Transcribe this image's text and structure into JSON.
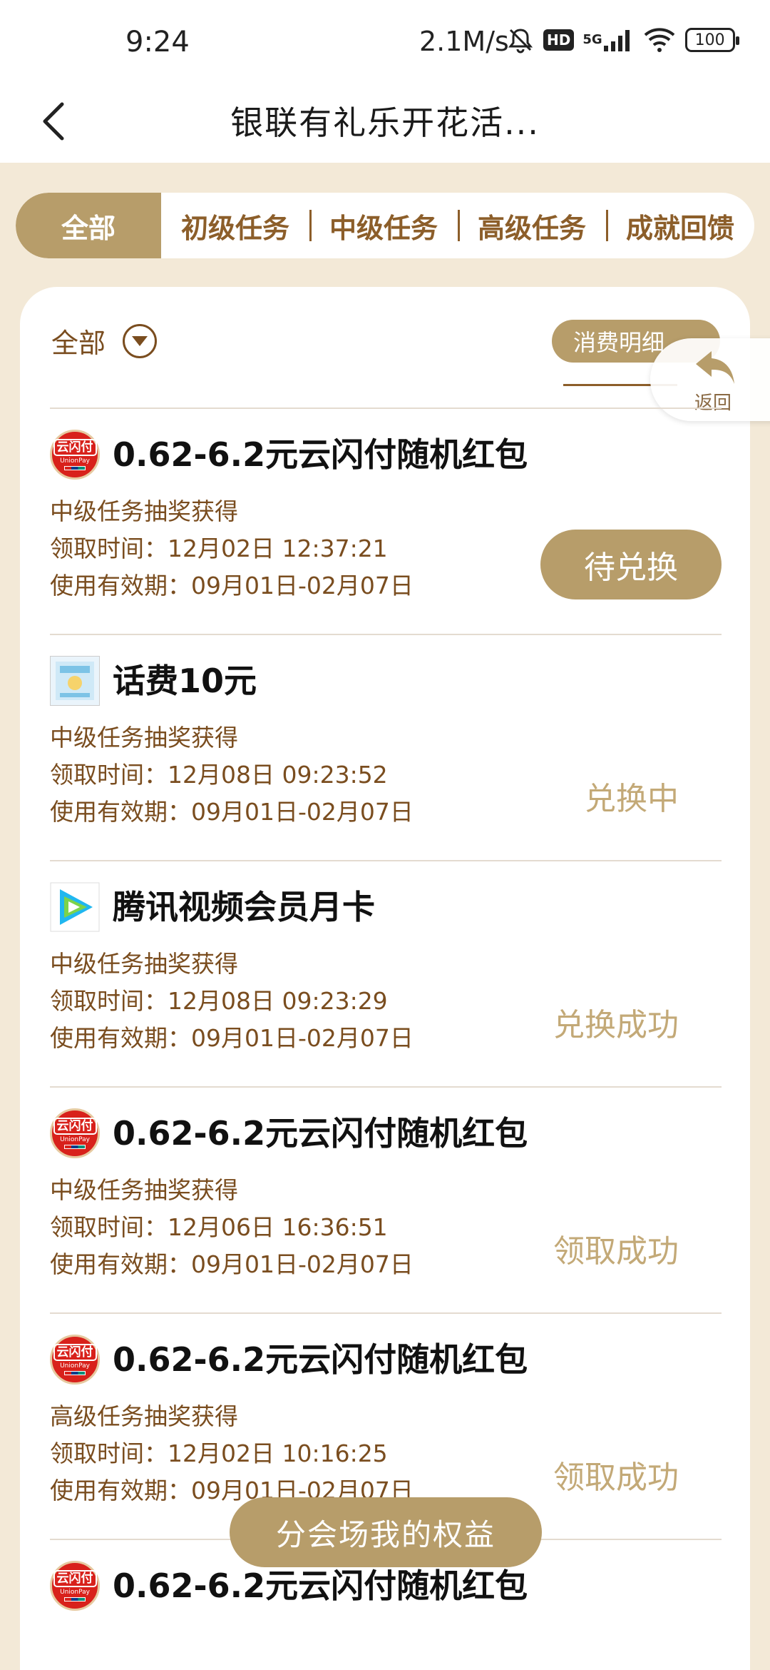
{
  "status_bar": {
    "time": "9:24",
    "network_speed": "2.1M/s",
    "hd_label": "HD",
    "signal_type": "5G",
    "battery": "100"
  },
  "header": {
    "title": "银联有礼乐开花活..."
  },
  "tabs": [
    {
      "label": "全部",
      "active": true
    },
    {
      "label": "初级任务",
      "active": false
    },
    {
      "label": "中级任务",
      "active": false
    },
    {
      "label": "高级任务",
      "active": false
    },
    {
      "label": "成就回馈",
      "active": false
    }
  ],
  "filter": {
    "label": "全部",
    "detail_button": "消费明细",
    "float_back_label": "返回"
  },
  "items": [
    {
      "icon": "unionpay-icon",
      "title": "0.62-6.2元云闪付随机红包",
      "source": "中级任务抽奖获得",
      "claim_time": "领取时间：12月02日 12:37:21",
      "validity": "使用有效期：09月01日-02月07日",
      "status": "待兑换",
      "status_style": "button"
    },
    {
      "icon": "phone-credit-icon",
      "title": "话费10元",
      "source": "中级任务抽奖获得",
      "claim_time": "领取时间：12月08日 09:23:52",
      "validity": "使用有效期：09月01日-02月07日",
      "status": "兑换中",
      "status_style": "text"
    },
    {
      "icon": "tencent-video-icon",
      "title": "腾讯视频会员月卡",
      "source": "中级任务抽奖获得",
      "claim_time": "领取时间：12月08日 09:23:29",
      "validity": "使用有效期：09月01日-02月07日",
      "status": "兑换成功",
      "status_style": "text"
    },
    {
      "icon": "unionpay-icon",
      "title": "0.62-6.2元云闪付随机红包",
      "source": "中级任务抽奖获得",
      "claim_time": "领取时间：12月06日 16:36:51",
      "validity": "使用有效期：09月01日-02月07日",
      "status": "领取成功",
      "status_style": "text"
    },
    {
      "icon": "unionpay-icon",
      "title": "0.62-6.2元云闪付随机红包",
      "source": "高级任务抽奖获得",
      "claim_time": "领取时间：12月02日 10:16:25",
      "validity": "使用有效期：09月01日-02月07日",
      "status": "领取成功",
      "status_style": "text"
    },
    {
      "icon": "unionpay-icon",
      "title": "0.62-6.2元云闪付随机红包"
    }
  ],
  "unionpay_logo_text": {
    "cn": "云闪付",
    "en": "UnionPay"
  },
  "bottom_button": "分会场我的权益",
  "colors": {
    "accent": "#b79d6a",
    "brown_text": "#7a4d1f",
    "status_text": "#c3a977",
    "page_bg": "#f3e9d7"
  }
}
